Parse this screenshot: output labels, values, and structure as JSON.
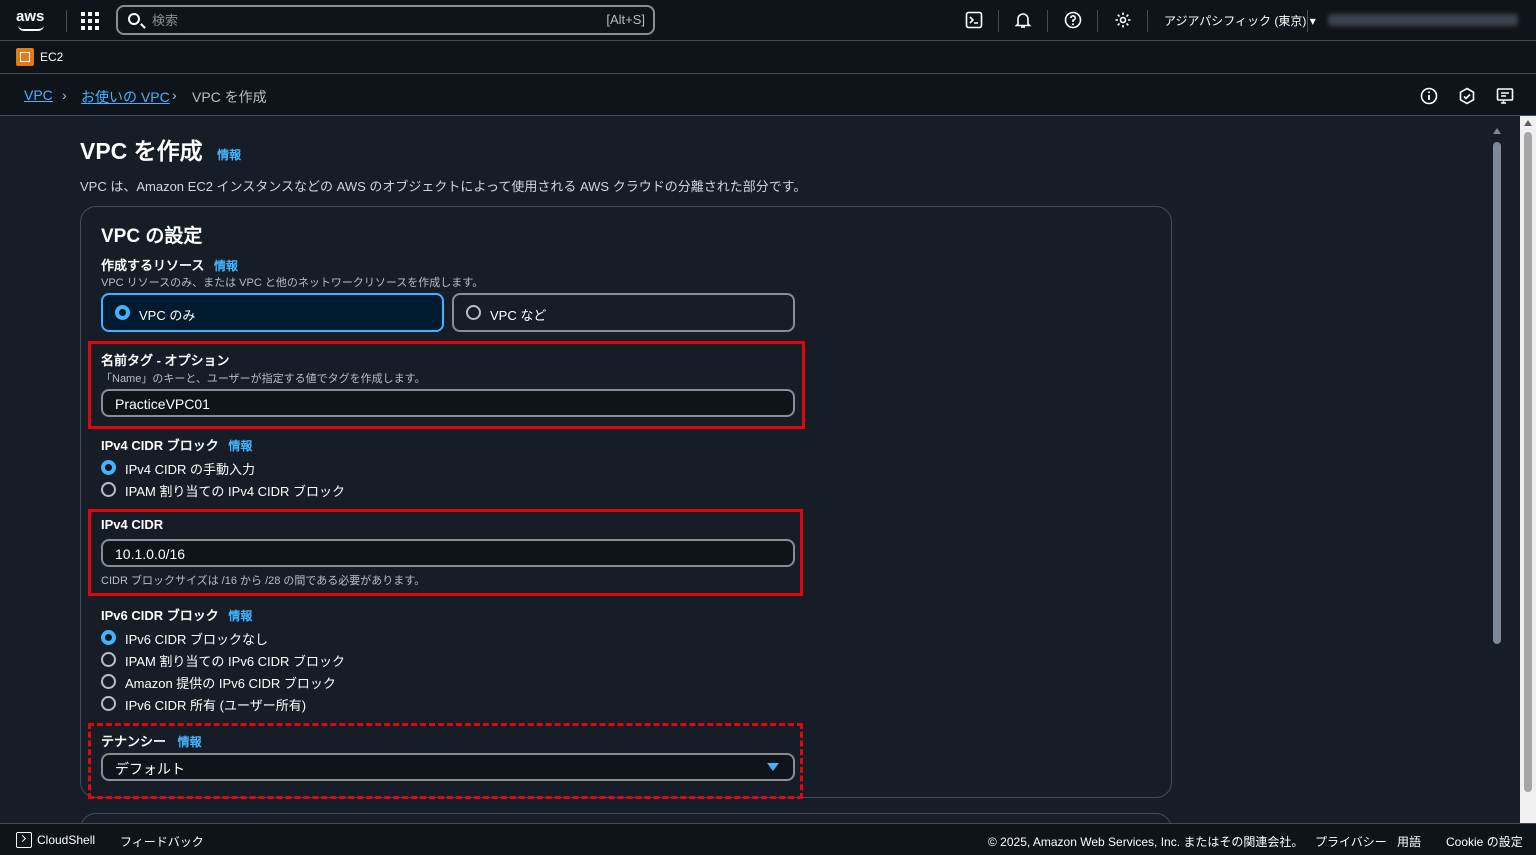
{
  "topbar": {
    "logo": "aws",
    "search_placeholder": "検索",
    "search_shortcut": "[Alt+S]",
    "region": "アジアパシフィック (東京) ▾",
    "icons": [
      "apps-icon",
      "cloudshell-icon",
      "bell-icon",
      "help-icon",
      "gear-icon"
    ]
  },
  "service": {
    "name": "EC2"
  },
  "breadcrumb": {
    "items": [
      "VPC",
      "お使いの VPC",
      "VPC を作成"
    ]
  },
  "page": {
    "title": "VPC を作成",
    "info": "情報",
    "description": "VPC は、Amazon EC2 インスタンスなどの AWS のオブジェクトによって使用される AWS クラウドの分離された部分です。"
  },
  "settings": {
    "title": "VPC の設定",
    "resources": {
      "label": "作成するリソース",
      "info": "情報",
      "description": "VPC リソースのみ、または VPC と他のネットワークリソースを作成します。",
      "options": [
        "VPC のみ",
        "VPC など"
      ],
      "selected": 0
    },
    "name_tag": {
      "label": "名前タグ - オプション",
      "description": "「Name」のキーと、ユーザーが指定する値でタグを作成します。",
      "value": "PracticeVPC01"
    },
    "ipv4_block": {
      "label": "IPv4 CIDR ブロック",
      "info": "情報",
      "options": [
        "IPv4 CIDR の手動入力",
        "IPAM 割り当ての IPv4 CIDR ブロック"
      ],
      "selected": 0
    },
    "ipv4_cidr": {
      "label": "IPv4 CIDR",
      "value": "10.1.0.0/16",
      "hint": "CIDR ブロックサイズは /16 から /28 の間である必要があります。"
    },
    "ipv6_block": {
      "label": "IPv6 CIDR ブロック",
      "info": "情報",
      "options": [
        "IPv6 CIDR ブロックなし",
        "IPAM 割り当ての IPv6 CIDR ブロック",
        "Amazon 提供の IPv6 CIDR ブロック",
        "IPv6 CIDR 所有 (ユーザー所有)"
      ],
      "selected": 0
    },
    "tenancy": {
      "label": "テナンシー",
      "info": "情報",
      "value": "デフォルト"
    }
  },
  "footer": {
    "cloudshell": "CloudShell",
    "feedback": "フィードバック",
    "copyright": "© 2025, Amazon Web Services, Inc. またはその関連会社。",
    "privacy": "プライバシー",
    "terms": "用語",
    "cookie": "Cookie の設定"
  },
  "colors": {
    "link": "#42b4ff",
    "highlight": "#e0050e",
    "background": "#161d26",
    "bar": "#0f141a"
  }
}
